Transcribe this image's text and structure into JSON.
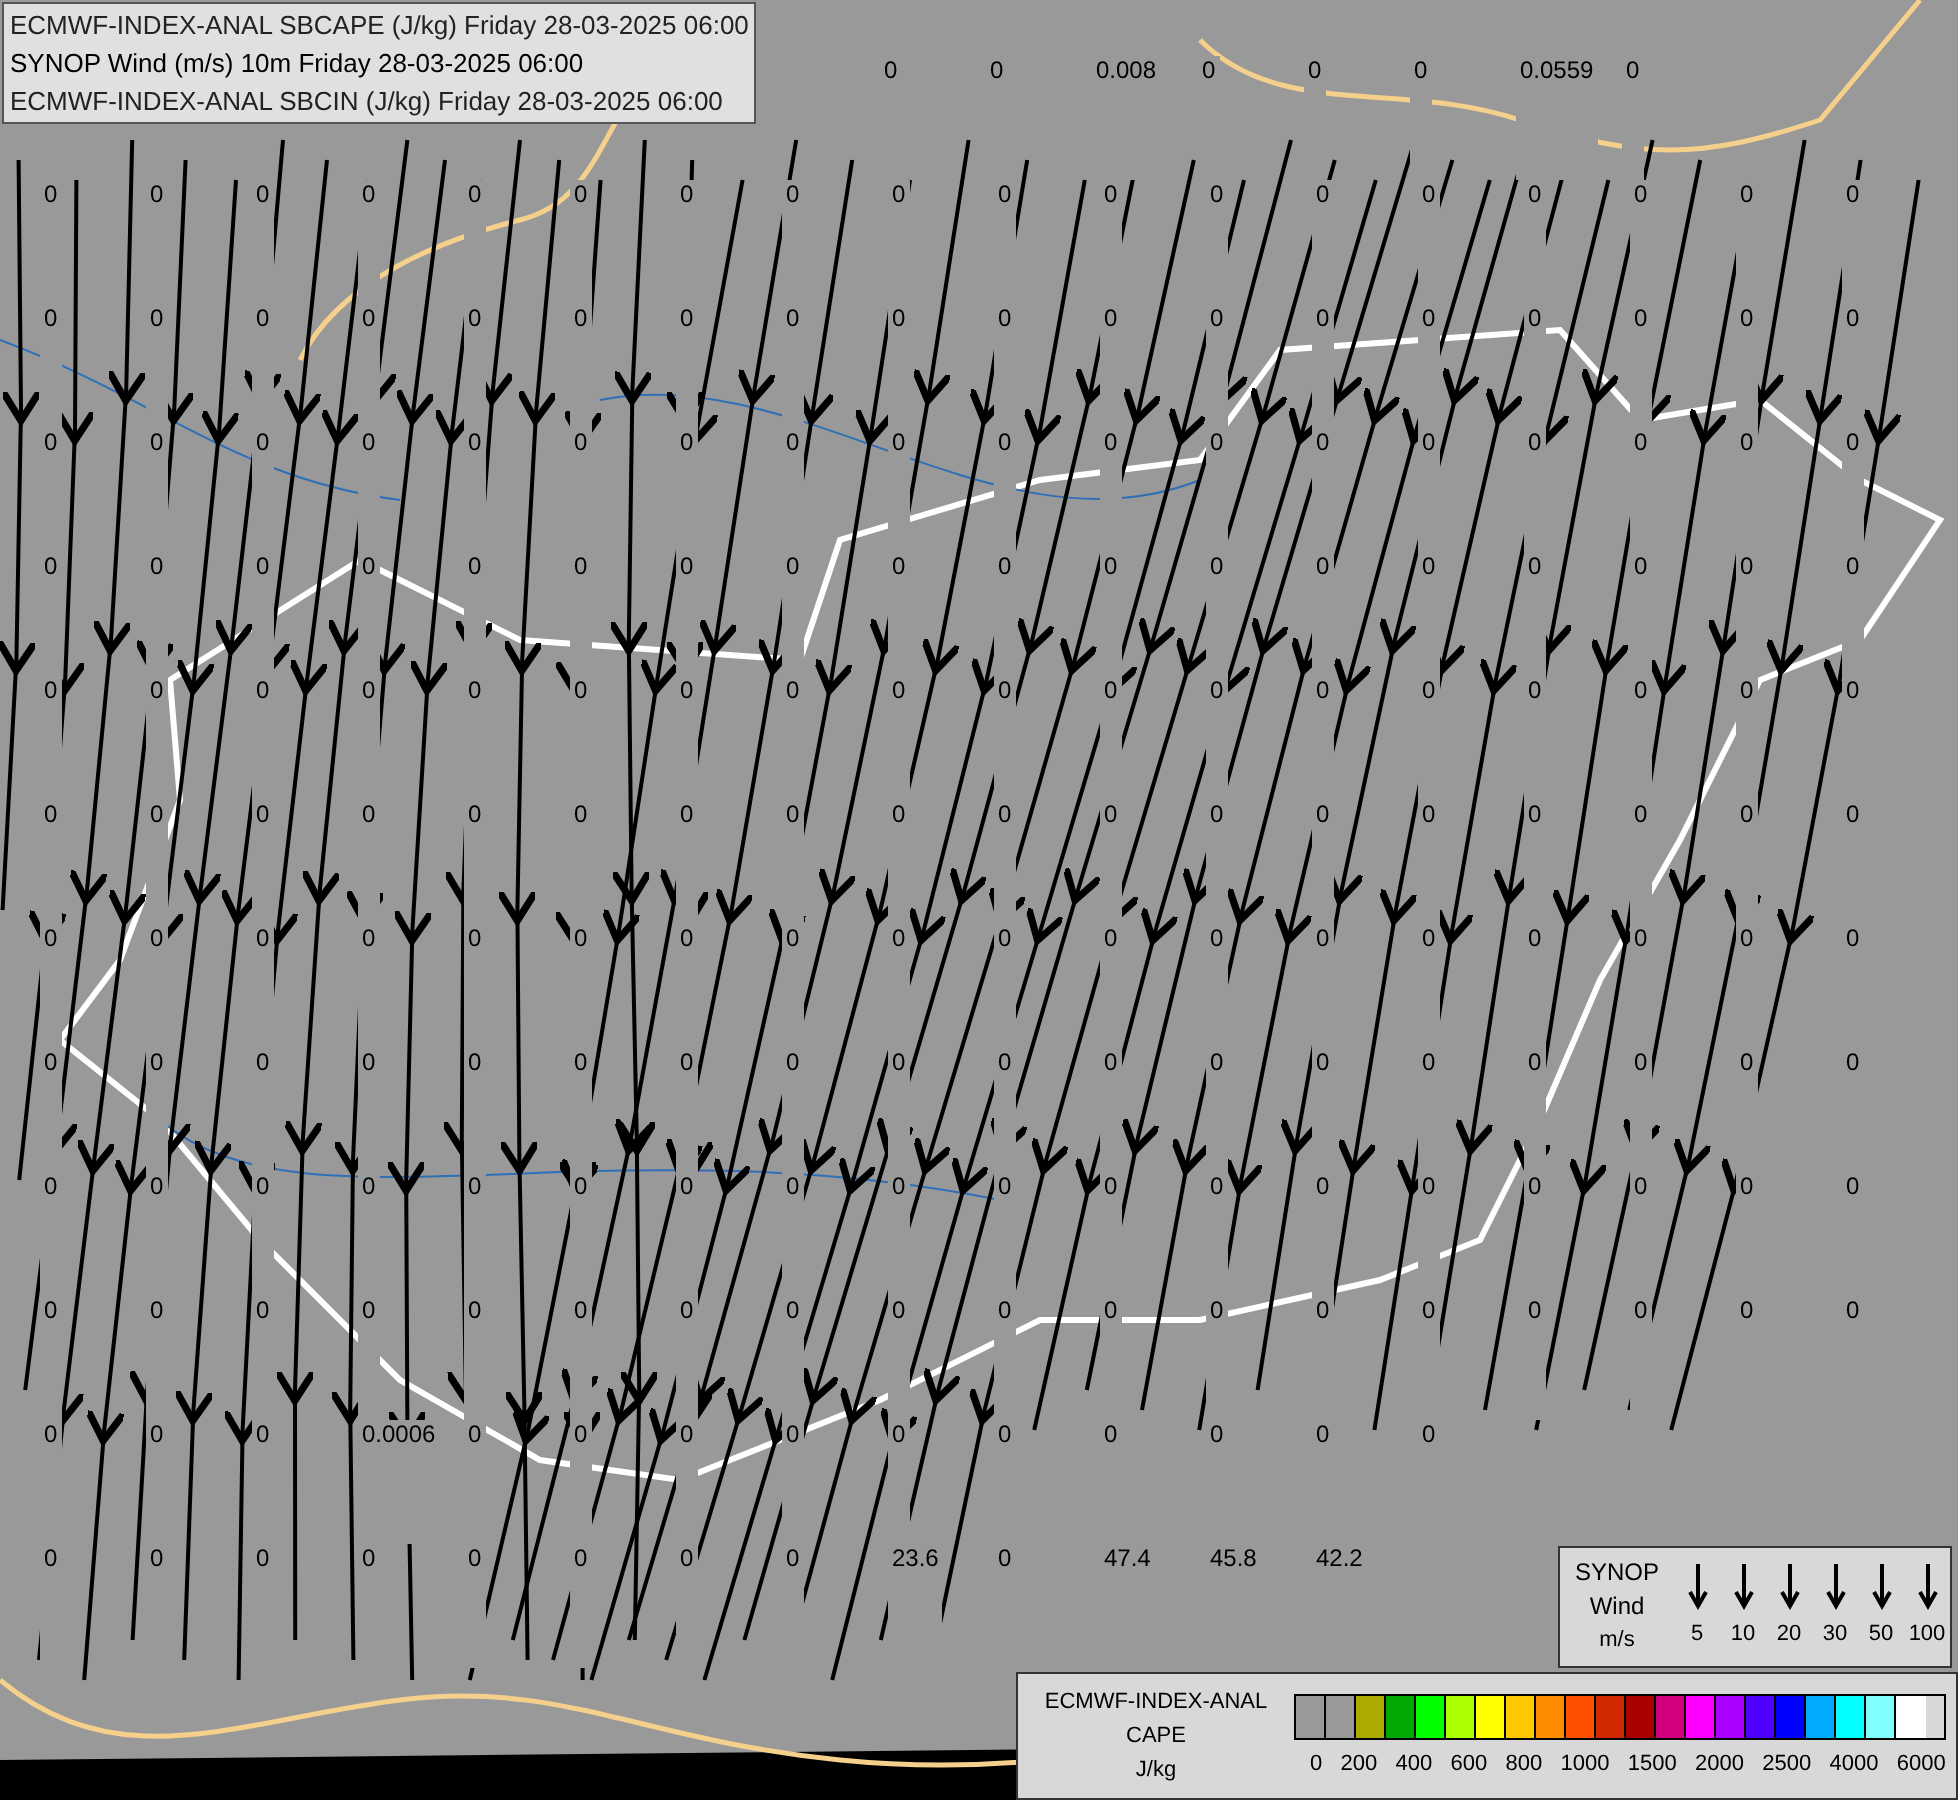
{
  "header": {
    "lines": [
      "ECMWF-INDEX-ANAL SBCAPE (J/kg) Friday 28-03-2025 06:00",
      "SYNOP Wind (m/s) 10m Friday 28-03-2025 06:00",
      "ECMWF-INDEX-ANAL SBCIN (J/kg) Friday 28-03-2025 06:00"
    ]
  },
  "map": {
    "value_rows": [
      [
        "0",
        "0",
        "0.008",
        "0",
        "0",
        "0",
        "0.0559",
        "0"
      ],
      [
        "0",
        "0",
        "0",
        "0",
        "0",
        "0",
        "0",
        "0",
        "0",
        "0",
        "0",
        "0",
        "0",
        "0",
        "0",
        "0",
        "0",
        "0"
      ],
      [
        "0",
        "0",
        "0",
        "0",
        "0",
        "0",
        "0",
        "0",
        "0",
        "0",
        "0",
        "0",
        "0",
        "0",
        "0",
        "0",
        "0",
        "0"
      ],
      [
        "0",
        "0",
        "0",
        "0",
        "0",
        "0",
        "0",
        "0",
        "0",
        "0",
        "0",
        "0",
        "0",
        "0",
        "0",
        "0",
        "0",
        "0"
      ],
      [
        "0",
        "0",
        "0",
        "0",
        "0",
        "0",
        "0",
        "0",
        "0",
        "0",
        "0",
        "0",
        "0",
        "0",
        "0",
        "0",
        "0",
        "0"
      ],
      [
        "0",
        "0",
        "0",
        "0",
        "0",
        "0",
        "0",
        "0",
        "0",
        "0",
        "0",
        "0",
        "0",
        "0",
        "0",
        "0",
        "0",
        "0"
      ],
      [
        "0",
        "0",
        "0",
        "0",
        "0",
        "0",
        "0",
        "0",
        "0",
        "0",
        "0",
        "0",
        "0",
        "0",
        "0",
        "0",
        "0",
        "0"
      ],
      [
        "0",
        "0",
        "0",
        "0",
        "0",
        "0",
        "0",
        "0",
        "0",
        "0",
        "0",
        "0",
        "0",
        "0",
        "0",
        "0",
        "0",
        "0"
      ],
      [
        "0",
        "0",
        "0",
        "0",
        "0",
        "0",
        "0",
        "0",
        "0",
        "0",
        "0",
        "0",
        "0",
        "0",
        "0",
        "0",
        "0",
        "0"
      ],
      [
        "0",
        "0",
        "0",
        "0",
        "0",
        "0",
        "0",
        "0",
        "0",
        "0",
        "0",
        "0",
        "0",
        "0",
        "0",
        "0",
        "0",
        "0"
      ],
      [
        "0",
        "0",
        "0",
        "0",
        "0",
        "0",
        "0",
        "0",
        "0",
        "0",
        "0",
        "0",
        "0",
        "0",
        "0",
        "0",
        "0",
        "0"
      ],
      [
        "0",
        "0",
        "0",
        "0.0006",
        "0",
        "0",
        "0",
        "0",
        "0",
        "0",
        "0",
        "0",
        "0",
        "0"
      ],
      [
        "0",
        "0",
        "0",
        "0",
        "0",
        "0",
        "0",
        "0",
        "23.6",
        "0",
        "47.4",
        "45.8",
        "42.2"
      ]
    ]
  },
  "synop_legend": {
    "title_lines": [
      "SYNOP",
      "Wind",
      "m/s"
    ],
    "speeds": [
      "5",
      "10",
      "20",
      "30",
      "50",
      "100"
    ]
  },
  "cape_legend": {
    "title_lines": [
      "ECMWF-INDEX-ANAL",
      "CAPE",
      "J/kg"
    ],
    "swatches": [
      {
        "color": "#999999"
      },
      {
        "color": "#999999"
      },
      {
        "color": "#aaaa00"
      },
      {
        "color": "#00aa00"
      },
      {
        "color": "#00ff00"
      },
      {
        "color": "#aaff00"
      },
      {
        "color": "#ffff00"
      },
      {
        "color": "#ffc800"
      },
      {
        "color": "#ff8c00"
      },
      {
        "color": "#ff5000"
      },
      {
        "color": "#d22800"
      },
      {
        "color": "#aa0000"
      },
      {
        "color": "#d2007d"
      },
      {
        "color": "#ff00ff"
      },
      {
        "color": "#aa00ff"
      },
      {
        "color": "#5000ff"
      },
      {
        "color": "#0000ff"
      },
      {
        "color": "#00aaff"
      },
      {
        "color": "#00ffff"
      },
      {
        "color": "#80ffff"
      },
      {
        "color": "#ffffff"
      }
    ],
    "ticks": [
      "0",
      "200",
      "400",
      "600",
      "800",
      "1000",
      "1500",
      "2000",
      "2500",
      "4000",
      "6000"
    ]
  }
}
